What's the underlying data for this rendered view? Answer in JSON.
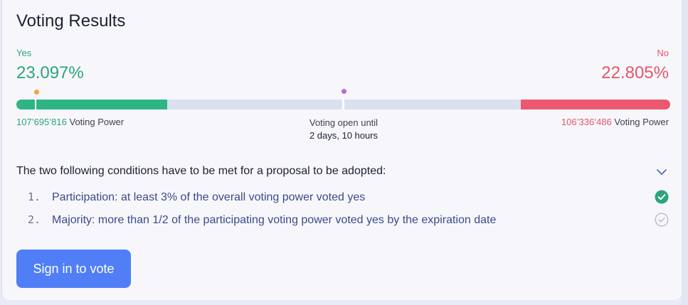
{
  "title": "Voting Results",
  "yes": {
    "label": "Yes",
    "percent": "23.097%",
    "voting_power_value": "107’695’816",
    "voting_power_label": "Voting Power",
    "color": "#2ba57a",
    "bar_fraction": 0.231
  },
  "no": {
    "label": "No",
    "percent": "22.805%",
    "voting_power_value": "106’336’486",
    "voting_power_label": "Voting Power",
    "color": "#e2566a",
    "bar_fraction": 0.228
  },
  "voting_open": {
    "label": "Voting open until",
    "time": "2 days, 10 hours"
  },
  "conditions": {
    "heading": "The two following conditions have to be met for a proposal to be adopted:",
    "items": [
      {
        "num": "1.",
        "text": "Participation: at least 3% of the overall voting power voted yes",
        "status": "met",
        "icon": "check-circle-filled-icon"
      },
      {
        "num": "2.",
        "text": "Majority: more than 1/2 of the participating voting power voted yes by the expiration date",
        "status": "unmet",
        "icon": "check-circle-outline-icon"
      }
    ]
  },
  "sign_in_button": "Sign in to vote",
  "colors": {
    "accent": "#4f7ef7",
    "bar_background": "#dbe0ef",
    "yes_bar": "#2db585",
    "no_bar": "#ec5870"
  }
}
